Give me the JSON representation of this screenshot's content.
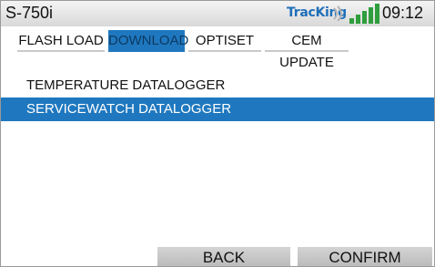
{
  "statusbar": {
    "device_name": "S-750i",
    "logo_text": "TracKing",
    "time": "09:12"
  },
  "tabs": [
    {
      "label": "FLASH LOAD",
      "active": false
    },
    {
      "label": "DOWNLOAD",
      "active": true
    },
    {
      "label": "OPTISET",
      "active": false
    },
    {
      "label": "CEM UPDATE",
      "active": false
    }
  ],
  "list": {
    "items": [
      {
        "label": "TEMPERATURE DATALOGGER",
        "selected": false
      },
      {
        "label": "SERVICEWATCH DATALOGGER",
        "selected": true
      }
    ]
  },
  "buttons": {
    "back": "BACK",
    "confirm": "CONFIRM"
  },
  "colors": {
    "accent": "#1f78bf",
    "logo": "#1f6fb8",
    "signal": "#2e9e3c"
  },
  "icons": {
    "logo_waves": "wifi-waves-icon",
    "logo_signal": "signal-bars-icon"
  }
}
